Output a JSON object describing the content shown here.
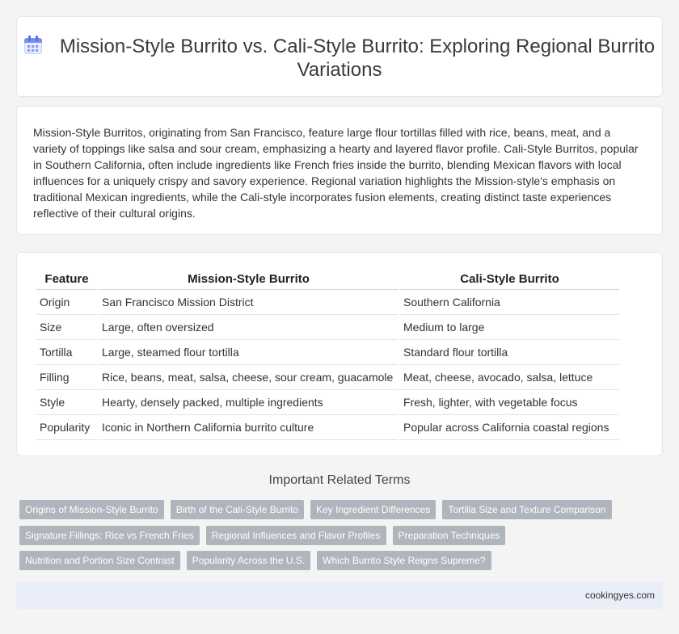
{
  "header": {
    "icon": "calendar-icon",
    "title": "Mission-Style Burrito vs. Cali-Style Burrito: Exploring Regional Burrito Variations"
  },
  "summary": {
    "text": "Mission-Style Burritos, originating from San Francisco, feature large flour tortillas filled with rice, beans, meat, and a variety of toppings like salsa and sour cream, emphasizing a hearty and layered flavor profile. Cali-Style Burritos, popular in Southern California, often include ingredients like French fries inside the burrito, blending Mexican flavors with local influences for a uniquely crispy and savory experience. Regional variation highlights the Mission-style's emphasis on traditional Mexican ingredients, while the Cali-style incorporates fusion elements, creating distinct taste experiences reflective of their cultural origins."
  },
  "table": {
    "headers": [
      "Feature",
      "Mission-Style Burrito",
      "Cali-Style Burrito"
    ],
    "rows": [
      [
        "Origin",
        "San Francisco Mission District",
        "Southern California"
      ],
      [
        "Size",
        "Large, often oversized",
        "Medium to large"
      ],
      [
        "Tortilla",
        "Large, steamed flour tortilla",
        "Standard flour tortilla"
      ],
      [
        "Filling",
        "Rice, beans, meat, salsa, cheese, sour cream, guacamole",
        "Meat, cheese, avocado, salsa, lettuce"
      ],
      [
        "Style",
        "Hearty, densely packed, multiple ingredients",
        "Fresh, lighter, with vegetable focus"
      ],
      [
        "Popularity",
        "Iconic in Northern California burrito culture",
        "Popular across California coastal regions"
      ]
    ]
  },
  "related": {
    "title": "Important Related Terms",
    "rows": [
      [
        "Origins of Mission-Style Burrito",
        "Birth of the Cali-Style Burrito",
        "Key Ingredient Differences",
        "Tortilla Size and Texture Comparison"
      ],
      [
        "Signature Fillings: Rice vs French Fries",
        "Regional Influences and Flavor Profiles",
        "Preparation Techniques"
      ],
      [
        "Nutrition and Portion Size Contrast",
        "Popularity Across the U.S.",
        "Which Burrito Style Reigns Supreme?"
      ]
    ]
  },
  "footer": {
    "site": "cookingyes.com"
  },
  "colors": {
    "background": "#f4f4f5",
    "tag": "#b0b4bd",
    "footer": "#eaeef8",
    "icon_accent": "#7b8ef0"
  }
}
